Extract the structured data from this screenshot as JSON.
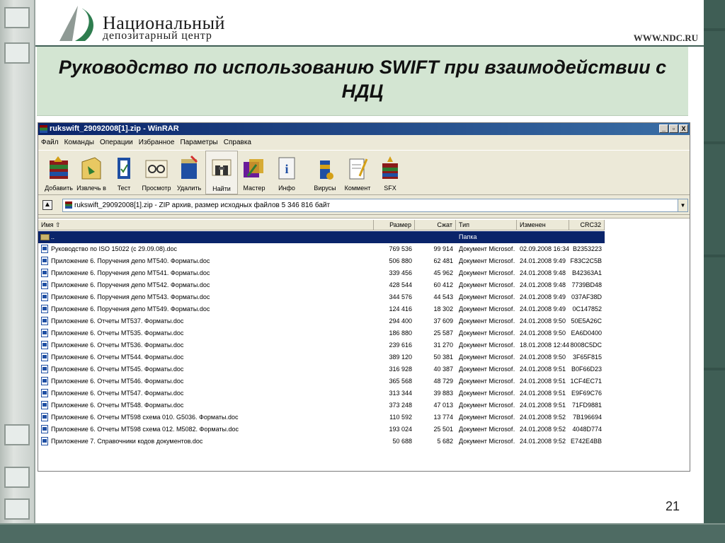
{
  "slide": {
    "logo_line1": "Национальный",
    "logo_line2": "депозитарный центр",
    "site": "WWW.NDC.RU",
    "title": "Руководство по использованию SWIFT при взаимодействии с НДЦ",
    "page_number": "21"
  },
  "window": {
    "title": "rukswift_29092008[1].zip - WinRAR",
    "controls": [
      "_",
      "▫",
      "X"
    ]
  },
  "menu": [
    "Файл",
    "Команды",
    "Операции",
    "Избранное",
    "Параметры",
    "Справка"
  ],
  "toolbar": [
    {
      "label": "Добавить",
      "icon": "add-icon"
    },
    {
      "label": "Извлечь в",
      "icon": "extract-icon"
    },
    {
      "label": "Тест",
      "icon": "test-icon"
    },
    {
      "label": "Просмотр",
      "icon": "view-icon"
    },
    {
      "label": "Удалить",
      "icon": "delete-icon"
    },
    {
      "label": "Найти",
      "icon": "find-icon"
    },
    {
      "label": "Мастер",
      "icon": "wizard-icon"
    },
    {
      "label": "Инфо",
      "icon": "info-icon"
    },
    {
      "label": "Вирусы",
      "icon": "virus-icon"
    },
    {
      "label": "Коммент",
      "icon": "comment-icon"
    },
    {
      "label": "SFX",
      "icon": "sfx-icon"
    }
  ],
  "address": "rukswift_29092008[1].zip - ZIP архив, размер исходных файлов 5 346 816 байт",
  "columns": [
    "Имя",
    "Размер",
    "Сжат",
    "Тип",
    "Изменен",
    "CRC32"
  ],
  "parent_row": {
    "name": "..",
    "type": "Папка"
  },
  "files": [
    {
      "name": "Руководство по ISO 15022 (с 29.09.08).doc",
      "size": "769 536",
      "packed": "99 914",
      "type": "Документ Microsof…",
      "modified": "02.09.2008 16:34",
      "crc": "B2353223"
    },
    {
      "name": "Приложение 6.  Поручения депо МТ540. Форматы.doc",
      "size": "506 880",
      "packed": "62 481",
      "type": "Документ Microsof…",
      "modified": "24.01.2008 9:49",
      "crc": "F83C2C5B"
    },
    {
      "name": "Приложение 6.  Поручения депо МТ541. Форматы.doc",
      "size": "339 456",
      "packed": "45 962",
      "type": "Документ Microsof…",
      "modified": "24.01.2008 9:48",
      "crc": "B42363A1"
    },
    {
      "name": "Приложение 6.  Поручения депо МТ542. Форматы.doc",
      "size": "428 544",
      "packed": "60 412",
      "type": "Документ Microsof…",
      "modified": "24.01.2008 9:48",
      "crc": "7739BD48"
    },
    {
      "name": "Приложение 6.  Поручения депо МТ543. Форматы.doc",
      "size": "344 576",
      "packed": "44 543",
      "type": "Документ Microsof…",
      "modified": "24.01.2008 9:49",
      "crc": "037AF38D"
    },
    {
      "name": "Приложение 6.  Поручения депо МТ549. Форматы.doc",
      "size": "124 416",
      "packed": "18 302",
      "type": "Документ Microsof…",
      "modified": "24.01.2008 9:49",
      "crc": "0C147852"
    },
    {
      "name": "Приложение 6. Отчеты МТ537. Форматы.doc",
      "size": "294 400",
      "packed": "37 609",
      "type": "Документ Microsof…",
      "modified": "24.01.2008 9:50",
      "crc": "50E5A26C"
    },
    {
      "name": "Приложение 6. Отчеты МТ535. Форматы.doc",
      "size": "186 880",
      "packed": "25 587",
      "type": "Документ Microsof…",
      "modified": "24.01.2008 9:50",
      "crc": "EA6D0400"
    },
    {
      "name": "Приложение 6. Отчеты МТ536. Форматы.doc",
      "size": "239 616",
      "packed": "31 270",
      "type": "Документ Microsof…",
      "modified": "18.01.2008 12:44",
      "crc": "8008C5DC"
    },
    {
      "name": "Приложение 6. Отчеты МТ544. Форматы.doc",
      "size": "389 120",
      "packed": "50 381",
      "type": "Документ Microsof…",
      "modified": "24.01.2008 9:50",
      "crc": "3F65F815"
    },
    {
      "name": "Приложение 6. Отчеты МТ545. Форматы.doc",
      "size": "316 928",
      "packed": "40 387",
      "type": "Документ Microsof…",
      "modified": "24.01.2008 9:51",
      "crc": "B0F66D23"
    },
    {
      "name": "Приложение 6. Отчеты МТ546. Форматы.doc",
      "size": "365 568",
      "packed": "48 729",
      "type": "Документ Microsof…",
      "modified": "24.01.2008 9:51",
      "crc": "1CF4EC71"
    },
    {
      "name": "Приложение 6. Отчеты МТ547. Форматы.doc",
      "size": "313 344",
      "packed": "39 883",
      "type": "Документ Microsof…",
      "modified": "24.01.2008 9:51",
      "crc": "E9F69C76"
    },
    {
      "name": "Приложение 6. Отчеты МТ548. Форматы.doc",
      "size": "373 248",
      "packed": "47 013",
      "type": "Документ Microsof…",
      "modified": "24.01.2008 9:51",
      "crc": "71FD9881"
    },
    {
      "name": "Приложение 6. Отчеты МТ598 схема 010. G5036. Форматы.doc",
      "size": "110 592",
      "packed": "13 774",
      "type": "Документ Microsof…",
      "modified": "24.01.2008 9:52",
      "crc": "7B196694"
    },
    {
      "name": "Приложение 6. Отчеты МТ598 схема 012. M5082. Форматы.doc",
      "size": "193 024",
      "packed": "25 501",
      "type": "Документ Microsof…",
      "modified": "24.01.2008 9:52",
      "crc": "4048D774"
    },
    {
      "name": "Приложение 7. Справочники кодов документов.doc",
      "size": "50 688",
      "packed": "5 682",
      "type": "Документ Microsof…",
      "modified": "24.01.2008 9:52",
      "crc": "E742E4BB"
    }
  ]
}
